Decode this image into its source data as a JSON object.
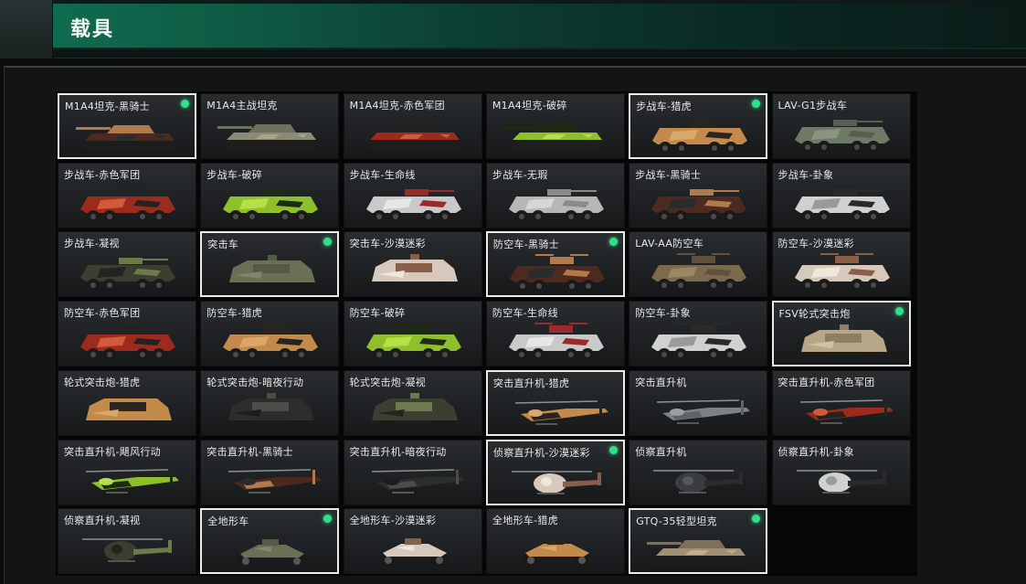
{
  "header": {
    "title": "载具"
  },
  "vehicles": [
    {
      "label": "M1A4坦克-黑骑士",
      "kind": "tank",
      "colors": [
        "#4c2a1f",
        "#b27a4b",
        "#2a2b2d"
      ],
      "selected": true,
      "active": true
    },
    {
      "label": "M1A4主战坦克",
      "kind": "tank",
      "colors": [
        "#8a8a76",
        "#6f6f5d",
        "#a6a48b"
      ],
      "selected": false,
      "active": false
    },
    {
      "label": "M1A4坦克-赤色军团",
      "kind": "tank",
      "colors": [
        "#9b2b1c",
        "#222222",
        "#d05a3a"
      ],
      "selected": false,
      "active": false
    },
    {
      "label": "M1A4坦克-破碎",
      "kind": "tank",
      "colors": [
        "#8ec02c",
        "#1f2a12",
        "#b6e045"
      ],
      "selected": false,
      "active": false
    },
    {
      "label": "步战车-猎虎",
      "kind": "ifv",
      "colors": [
        "#c28b4b",
        "#2a2420",
        "#d9a868"
      ],
      "selected": true,
      "active": true
    },
    {
      "label": "LAV-G1步战车",
      "kind": "ifv",
      "colors": [
        "#6f7a66",
        "#55604f",
        "#8a9480"
      ],
      "selected": false,
      "active": false
    },
    {
      "label": "步战车-赤色军团",
      "kind": "ifv",
      "colors": [
        "#9b2b1c",
        "#232323",
        "#d05a3a"
      ],
      "selected": false,
      "active": false
    },
    {
      "label": "步战车-破碎",
      "kind": "ifv",
      "colors": [
        "#8ec02c",
        "#1f2a12",
        "#b6e045"
      ],
      "selected": false,
      "active": false
    },
    {
      "label": "步战车-生命线",
      "kind": "ifv",
      "colors": [
        "#c9c9c9",
        "#9b2b2b",
        "#e6e6e6"
      ],
      "selected": false,
      "active": false
    },
    {
      "label": "步战车-无瑕",
      "kind": "ifv",
      "colors": [
        "#b7b7b7",
        "#8a8a8a",
        "#d6d6d6"
      ],
      "selected": false,
      "active": false
    },
    {
      "label": "步战车-黑骑士",
      "kind": "ifv",
      "colors": [
        "#4c2a1f",
        "#b27a4b",
        "#2a2b2d"
      ],
      "selected": false,
      "active": false
    },
    {
      "label": "步战车-卦象",
      "kind": "ifv",
      "colors": [
        "#d0d0d0",
        "#2a2a2a",
        "#9a9a9a"
      ],
      "selected": false,
      "active": false
    },
    {
      "label": "步战车-凝视",
      "kind": "ifv",
      "colors": [
        "#3a3f32",
        "#6c7a4d",
        "#22251f"
      ],
      "selected": false,
      "active": false
    },
    {
      "label": "突击车",
      "kind": "mrap",
      "colors": [
        "#6a6f56",
        "#565a46",
        "#80866a"
      ],
      "selected": true,
      "active": true
    },
    {
      "label": "突击车-沙漠迷彩",
      "kind": "mrap",
      "colors": [
        "#d6c9bb",
        "#8a5f4a",
        "#efe6dc"
      ],
      "selected": false,
      "active": false
    },
    {
      "label": "防空车-黑骑士",
      "kind": "aa",
      "colors": [
        "#4c2a1f",
        "#b27a4b",
        "#2a2b2d"
      ],
      "selected": true,
      "active": true
    },
    {
      "label": "LAV-AA防空车",
      "kind": "aa",
      "colors": [
        "#7b6a4d",
        "#5f523c",
        "#9a8662"
      ],
      "selected": false,
      "active": false
    },
    {
      "label": "防空车-沙漠迷彩",
      "kind": "aa",
      "colors": [
        "#d6c9bb",
        "#8a5f4a",
        "#efe6dc"
      ],
      "selected": false,
      "active": false
    },
    {
      "label": "防空车-赤色军团",
      "kind": "aa",
      "colors": [
        "#9b2b1c",
        "#232323",
        "#d05a3a"
      ],
      "selected": false,
      "active": false
    },
    {
      "label": "防空车-猎虎",
      "kind": "aa",
      "colors": [
        "#c28b4b",
        "#2a2420",
        "#d9a868"
      ],
      "selected": false,
      "active": false
    },
    {
      "label": "防空车-破碎",
      "kind": "aa",
      "colors": [
        "#8ec02c",
        "#1f2a12",
        "#b6e045"
      ],
      "selected": false,
      "active": false
    },
    {
      "label": "防空车-生命线",
      "kind": "aa",
      "colors": [
        "#c9c9c9",
        "#9b2b2b",
        "#e6e6e6"
      ],
      "selected": false,
      "active": false
    },
    {
      "label": "防空车-卦象",
      "kind": "aa",
      "colors": [
        "#d0d0d0",
        "#2a2a2a",
        "#9a9a9a"
      ],
      "selected": false,
      "active": false
    },
    {
      "label": "FSV轮式突击炮",
      "kind": "mrap",
      "colors": [
        "#b7a788",
        "#8d7f64",
        "#d2c2a2"
      ],
      "selected": true,
      "active": true
    },
    {
      "label": "轮式突击炮-猎虎",
      "kind": "mrap",
      "colors": [
        "#c28b4b",
        "#2a2420",
        "#d9a868"
      ],
      "selected": false,
      "active": false
    },
    {
      "label": "轮式突击炮-暗夜行动",
      "kind": "mrap",
      "colors": [
        "#2b2e2b",
        "#4a4d48",
        "#1b1c1b"
      ],
      "selected": false,
      "active": false
    },
    {
      "label": "轮式突击炮-凝视",
      "kind": "mrap",
      "colors": [
        "#3a3f32",
        "#6c7a4d",
        "#22251f"
      ],
      "selected": false,
      "active": false
    },
    {
      "label": "突击直升机-猎虎",
      "kind": "heli",
      "colors": [
        "#c28b4b",
        "#2a2420",
        "#d9a868"
      ],
      "selected": true,
      "active": false
    },
    {
      "label": "突击直升机",
      "kind": "heli",
      "colors": [
        "#7d8284",
        "#5f6365",
        "#9ba0a2"
      ],
      "selected": false,
      "active": false
    },
    {
      "label": "突击直升机-赤色军团",
      "kind": "heli",
      "colors": [
        "#9b2b1c",
        "#232323",
        "#d05a3a"
      ],
      "selected": false,
      "active": false
    },
    {
      "label": "突击直升机-飓风行动",
      "kind": "heli",
      "colors": [
        "#8ec02c",
        "#1f2a12",
        "#b6e045"
      ],
      "selected": false,
      "active": false
    },
    {
      "label": "突击直升机-黑骑士",
      "kind": "heli",
      "colors": [
        "#4c2a1f",
        "#b27a4b",
        "#2a2b2d"
      ],
      "selected": false,
      "active": false
    },
    {
      "label": "突击直升机-暗夜行动",
      "kind": "heli",
      "colors": [
        "#2b2e2b",
        "#4a4d48",
        "#1b1c1b"
      ],
      "selected": false,
      "active": false
    },
    {
      "label": "侦察直升机-沙漠迷彩",
      "kind": "scout",
      "colors": [
        "#d6c9bb",
        "#8a5f4a",
        "#efe6dc"
      ],
      "selected": true,
      "active": true
    },
    {
      "label": "侦察直升机",
      "kind": "scout",
      "colors": [
        "#3a3d3f",
        "#2a2c2e",
        "#55595c"
      ],
      "selected": false,
      "active": false
    },
    {
      "label": "侦察直升机-卦象",
      "kind": "scout",
      "colors": [
        "#d0d0d0",
        "#2a2a2a",
        "#9a9a9a"
      ],
      "selected": false,
      "active": false
    },
    {
      "label": "侦察直升机-凝视",
      "kind": "scout",
      "colors": [
        "#3a3f32",
        "#6c7a4d",
        "#22251f"
      ],
      "selected": false,
      "active": false
    },
    {
      "label": "全地形车",
      "kind": "atv",
      "colors": [
        "#6a6f56",
        "#565a46",
        "#80866a"
      ],
      "selected": true,
      "active": true
    },
    {
      "label": "全地形车-沙漠迷彩",
      "kind": "atv",
      "colors": [
        "#d6c9bb",
        "#8a5f4a",
        "#efe6dc"
      ],
      "selected": false,
      "active": false
    },
    {
      "label": "全地形车-猎虎",
      "kind": "atv",
      "colors": [
        "#c28b4b",
        "#2a2420",
        "#d9a868"
      ],
      "selected": false,
      "active": false
    },
    {
      "label": "GTQ-35轻型坦克",
      "kind": "tank",
      "colors": [
        "#a08f75",
        "#7d6f59",
        "#c1ae8e"
      ],
      "selected": true,
      "active": true
    }
  ]
}
